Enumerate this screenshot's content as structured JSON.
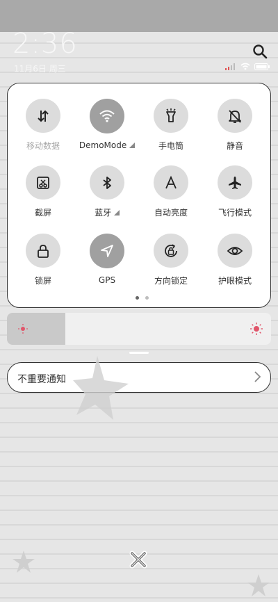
{
  "status_bar": {
    "time": "2:36",
    "date": "11月6日 周三"
  },
  "control_center": {
    "tiles": [
      {
        "label": "移动数据",
        "icon": "mobile-data-icon",
        "active": false,
        "dim_label": true
      },
      {
        "label": "DemoMode",
        "icon": "wifi-icon",
        "active": true,
        "dim_label": false,
        "has_arrow": true
      },
      {
        "label": "手电筒",
        "icon": "flashlight-icon",
        "active": false,
        "dim_label": false
      },
      {
        "label": "静音",
        "icon": "mute-bell-icon",
        "active": false,
        "dim_label": false
      },
      {
        "label": "截屏",
        "icon": "screenshot-icon",
        "active": false,
        "dim_label": false
      },
      {
        "label": "蓝牙",
        "icon": "bluetooth-icon",
        "active": false,
        "dim_label": false,
        "has_arrow": true
      },
      {
        "label": "自动亮度",
        "icon": "auto-brightness-icon",
        "active": false,
        "dim_label": false
      },
      {
        "label": "飞行模式",
        "icon": "airplane-icon",
        "active": false,
        "dim_label": false
      },
      {
        "label": "锁屏",
        "icon": "lock-icon",
        "active": false,
        "dim_label": false
      },
      {
        "label": "GPS",
        "icon": "location-arrow-icon",
        "active": true,
        "dim_label": false
      },
      {
        "label": "方向锁定",
        "icon": "rotation-lock-icon",
        "active": false,
        "dim_label": false
      },
      {
        "label": "护眼模式",
        "icon": "eye-icon",
        "active": false,
        "dim_label": false
      }
    ],
    "pages": {
      "count": 2,
      "current": 1
    }
  },
  "brightness": {
    "level": 0.22,
    "accent": "#e0556a"
  },
  "notification": {
    "label": "不重要通知"
  },
  "colors": {
    "active_tile": "#a0a0a0",
    "inactive_tile": "#dcdcdc",
    "brightness_icon": "#e0556a"
  }
}
